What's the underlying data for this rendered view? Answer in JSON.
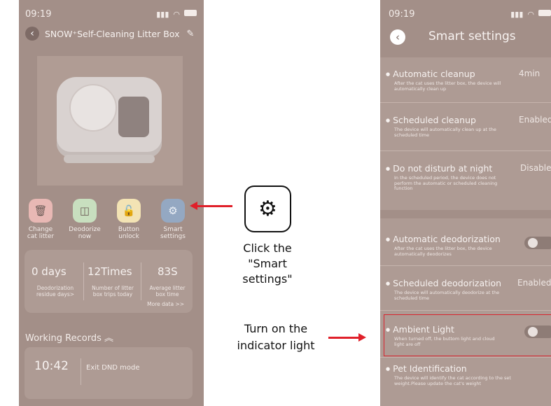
{
  "left_screen": {
    "status_time": "09:19",
    "title": "SNOW⁺Self-Cleaning Litter Box",
    "actions": [
      {
        "label_line1": "Change",
        "label_line2": "cat litter",
        "icon": "trash-icon",
        "color": "#e8b8b4"
      },
      {
        "label_line1": "Deodorize",
        "label_line2": "now",
        "icon": "deodorize-icon",
        "color": "#c8dfbf"
      },
      {
        "label_line1": "Button",
        "label_line2": "unlock",
        "icon": "lock-icon",
        "color": "#f3e3b4"
      },
      {
        "label_line1": "Smart",
        "label_line2": "settings",
        "icon": "gear-icon",
        "color": "#94a8c2"
      }
    ],
    "stats": [
      {
        "value": "0 days",
        "label_line1": "Deodorization",
        "label_line2": "residue days>"
      },
      {
        "value": "12Times",
        "label_line1": "Number of litter",
        "label_line2": "box trips today"
      },
      {
        "value": "83S",
        "label_line1": "Average litter",
        "label_line2": "box time"
      }
    ],
    "more_data": "More data >>",
    "working_records_label": "Working Records",
    "record": {
      "time": "10:42",
      "text": "Exit DND mode"
    }
  },
  "annotations": {
    "click_caption_line1": "Click the",
    "click_caption_line2": "\"Smart settings\"",
    "light_caption_line1": "Turn on the",
    "light_caption_line2": "indicator light",
    "arrow_color": "#e0202a"
  },
  "right_screen": {
    "status_time": "09:19",
    "title": "Smart settings",
    "items": [
      {
        "title": "Automatic cleanup",
        "value": "4min",
        "desc": "After the cat uses the litter box, the device will automatically clean up"
      },
      {
        "title": "Scheduled cleanup",
        "value": "Enabled",
        "desc": "The device will automatically clean up at the scheduled time"
      },
      {
        "title": "Do not disturb at night",
        "value": "Disabled",
        "desc": "In the scheduled period, the device does not perform the automatic or scheduled cleaning function"
      },
      {
        "title": "Automatic deodorization",
        "value": "",
        "desc": "After the cat uses the litter box, the device automatically deodorizes"
      },
      {
        "title": "Scheduled deodorization",
        "value": "Enabled",
        "desc": "The device will automatically deodorize at the scheduled time"
      },
      {
        "title": "Ambient Light",
        "value": "",
        "desc": "When turned off, the buttom light and cloud light are off"
      },
      {
        "title": "Pet Identification",
        "value": "",
        "desc": "The device will identify the cat according to the set weight.Please update the cat's weight"
      }
    ]
  }
}
